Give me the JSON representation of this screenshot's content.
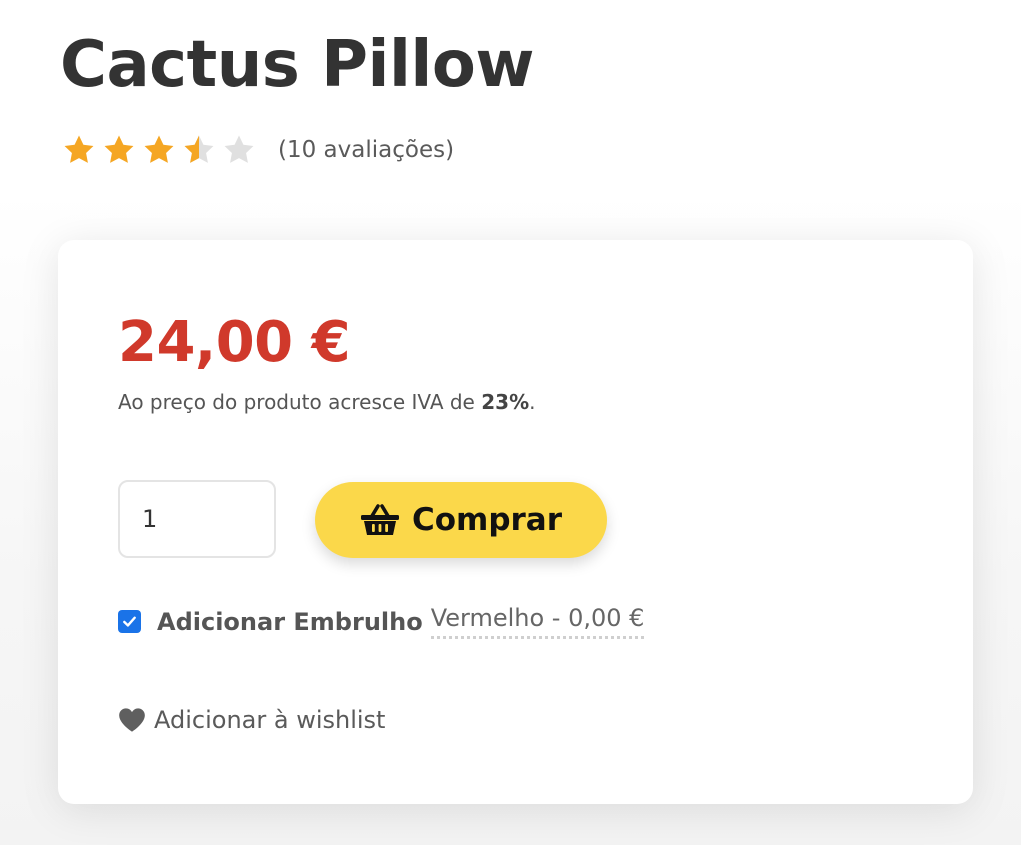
{
  "product": {
    "title": "Cactus Pillow",
    "rating": {
      "value": 3.5,
      "max": 5,
      "filled_color": "#f5a623",
      "empty_color": "#e0e0e0",
      "review_count_text": "(10 avaliações)"
    }
  },
  "purchase": {
    "price": "24,00 €",
    "price_color": "#d0392b",
    "vat_note_prefix": "Ao preço do produto acresce IVA de ",
    "vat_rate": "23%",
    "vat_note_suffix": ".",
    "quantity": "1",
    "buy_label": "Comprar",
    "buy_icon": "basket-icon",
    "buy_color": "#fbd84a",
    "gift_wrap": {
      "checked": true,
      "label": "Adicionar Embrulho",
      "option": "Vermelho - 0,00 €"
    },
    "wishlist_label": "Adicionar à wishlist",
    "wishlist_icon": "heart-icon"
  }
}
